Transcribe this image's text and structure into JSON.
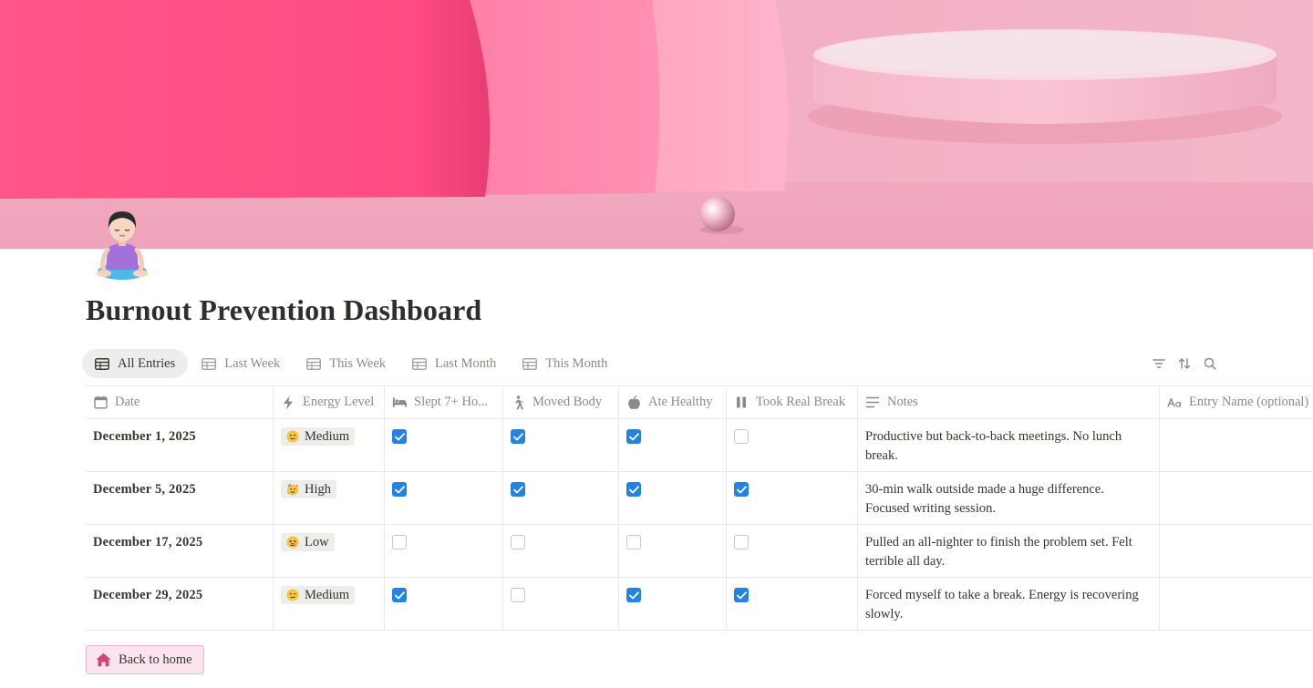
{
  "page": {
    "title": "Burnout Prevention Dashboard",
    "icon": "meditating-person-icon",
    "cover": "pink-podium-cover"
  },
  "tabs": [
    {
      "label": "All Entries",
      "icon": "table-icon",
      "active": true
    },
    {
      "label": "Last Week",
      "icon": "table-icon",
      "active": false
    },
    {
      "label": "This Week",
      "icon": "table-icon",
      "active": false
    },
    {
      "label": "Last Month",
      "icon": "table-icon",
      "active": false
    },
    {
      "label": "This Month",
      "icon": "table-icon",
      "active": false
    }
  ],
  "toolbar": {
    "filter_icon": "filter-icon",
    "sort_icon": "sort-icon",
    "search_icon": "search-icon"
  },
  "table": {
    "columns": [
      {
        "label": "Date",
        "icon": "calendar-icon"
      },
      {
        "label": "Energy Level",
        "icon": "lightning-icon"
      },
      {
        "label": "Slept 7+ Ho...",
        "icon": "bed-icon"
      },
      {
        "label": "Moved Body",
        "icon": "walking-icon"
      },
      {
        "label": "Ate Healthy",
        "icon": "apple-icon"
      },
      {
        "label": "Took Real Break",
        "icon": "pause-icon"
      },
      {
        "label": "Notes",
        "icon": "text-lines-icon"
      },
      {
        "label": "Entry Name (optional)",
        "icon": "title-aa-icon"
      }
    ],
    "rows": [
      {
        "date": "December 1, 2025",
        "energy": "Medium",
        "energy_emoji": "neutral-face-icon",
        "slept": true,
        "moved": true,
        "ate": true,
        "break": false,
        "notes": "Productive but back-to-back meetings. No lunch break.",
        "name": ""
      },
      {
        "date": "December 5, 2025",
        "energy": "High",
        "energy_emoji": "party-face-icon",
        "slept": true,
        "moved": true,
        "ate": true,
        "break": true,
        "notes": "30-min walk outside made a huge difference. Focused writing session.",
        "name": ""
      },
      {
        "date": "December 17, 2025",
        "energy": "Low",
        "energy_emoji": "tired-face-icon",
        "slept": false,
        "moved": false,
        "ate": false,
        "break": false,
        "notes": "Pulled an all-nighter to finish the problem set. Felt terrible all day.",
        "name": ""
      },
      {
        "date": "December 29, 2025",
        "energy": "Medium",
        "energy_emoji": "neutral-face-icon",
        "slept": true,
        "moved": false,
        "ate": true,
        "break": true,
        "notes": "Forced myself to take a break. Energy is recovering slowly.",
        "name": ""
      }
    ]
  },
  "back_button": {
    "label": "Back to home",
    "icon": "home-icon"
  },
  "colors": {
    "accent_blue": "#2383e2",
    "pill_bg": "#ededeb",
    "back_button_bg": "#fbe4ee",
    "home_icon": "#d1457a",
    "cover_pink_dark": "#ff4f86",
    "cover_pink_mid": "#ff85ad",
    "cover_pink_light": "#f6b3c7"
  }
}
